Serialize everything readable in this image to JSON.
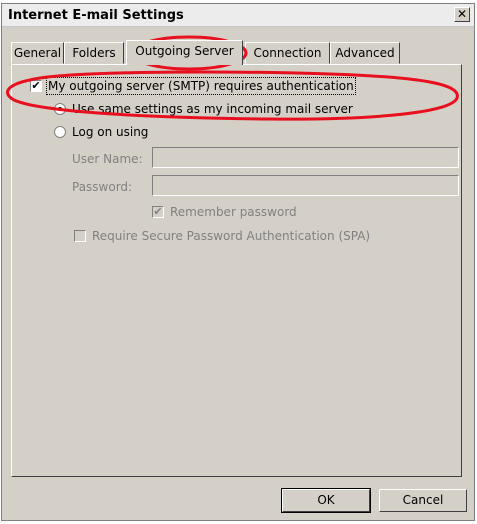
{
  "window": {
    "title": "Internet E-mail Settings",
    "close_glyph": "✕"
  },
  "tabs": [
    {
      "label": "General"
    },
    {
      "label": "Folders"
    },
    {
      "label": "Outgoing Server"
    },
    {
      "label": "Connection"
    },
    {
      "label": "Advanced"
    }
  ],
  "active_tab": "Outgoing Server",
  "auth": {
    "requires_auth_label": "My outgoing server (SMTP) requires authentication",
    "requires_auth_checked": true,
    "use_same_label": "Use same settings as my incoming mail server",
    "use_same_selected": true,
    "log_on_label": "Log on using",
    "log_on_selected": false,
    "user_name_label": "User Name:",
    "user_name_value": "",
    "password_label": "Password:",
    "password_value": "",
    "remember_password_label": "Remember password",
    "remember_password_checked": true,
    "spa_label": "Require Secure Password Authentication (SPA)",
    "spa_checked": false
  },
  "buttons": {
    "ok": "OK",
    "cancel": "Cancel"
  },
  "annotation_color": "#e8101e",
  "icons": {
    "check": "✔"
  }
}
